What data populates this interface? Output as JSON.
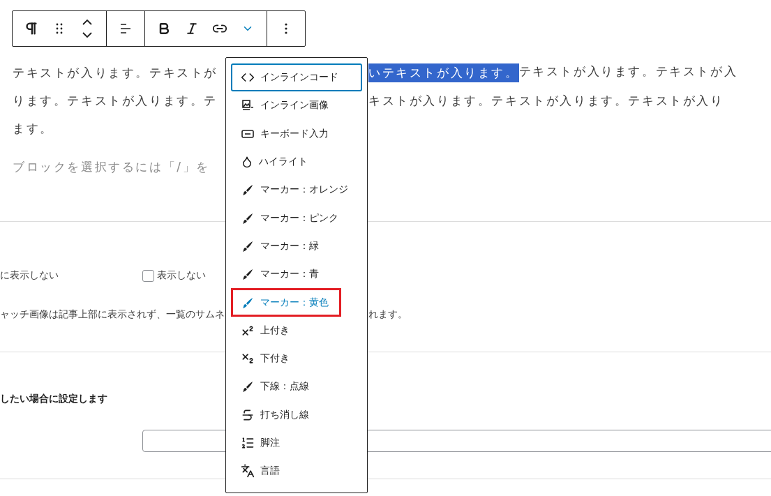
{
  "toolbar": {
    "groups": [
      {
        "buttons": [
          {
            "kind": "paragraph"
          },
          {
            "kind": "drag"
          },
          {
            "kind": "move"
          }
        ]
      },
      {
        "buttons": [
          {
            "kind": "align"
          }
        ]
      },
      {
        "buttons": [
          {
            "kind": "bold"
          },
          {
            "kind": "italic"
          },
          {
            "kind": "link"
          },
          {
            "kind": "more-formats",
            "expanded": true
          }
        ]
      },
      {
        "buttons": [
          {
            "kind": "options"
          }
        ]
      }
    ]
  },
  "paragraph": {
    "lines": [
      {
        "left": "テキストが入ります。テキストが",
        "selected_text": "いテキストが入ります。",
        "right": "テキストが入ります。テキストが入"
      },
      {
        "left": "ります。テキストが入ります。テ",
        "right": "キストが入ります。テキストが入ります。テキストが入り"
      },
      {
        "left": "ます。"
      }
    ]
  },
  "placeholder": "ブロックを選択するには「/」を",
  "settings": {
    "label_left": "に表示しない",
    "checkbox": {
      "label": "表示しない",
      "checked": false
    },
    "note_left": "ャッチ画像は記事上部に表示されず、一覧のサムネ",
    "note_right": "れます。",
    "section_title": "したい場合に設定します"
  },
  "format_menu": {
    "items": [
      {
        "kind": "code",
        "label": "インラインコード",
        "focused": true,
        "active": false,
        "marked": false
      },
      {
        "kind": "image",
        "label": "インライン画像",
        "focused": false,
        "active": false,
        "marked": false
      },
      {
        "kind": "keyboard",
        "label": "キーボード入力",
        "focused": false,
        "active": false,
        "marked": false
      },
      {
        "kind": "drop",
        "label": "ハイライト",
        "focused": false,
        "active": false,
        "marked": false
      },
      {
        "kind": "brush",
        "label": "マーカー：オレンジ",
        "focused": false,
        "active": false,
        "marked": false
      },
      {
        "kind": "brush",
        "label": "マーカー：ピンク",
        "focused": false,
        "active": false,
        "marked": false
      },
      {
        "kind": "brush",
        "label": "マーカー：緑",
        "focused": false,
        "active": false,
        "marked": false
      },
      {
        "kind": "brush",
        "label": "マーカー：青",
        "focused": false,
        "active": false,
        "marked": false
      },
      {
        "kind": "brush",
        "label": "マーカー：黄色",
        "focused": false,
        "active": true,
        "marked": true
      },
      {
        "kind": "superscript",
        "label": "上付き",
        "focused": false,
        "active": false,
        "marked": false
      },
      {
        "kind": "subscript",
        "label": "下付き",
        "focused": false,
        "active": false,
        "marked": false
      },
      {
        "kind": "brush",
        "label": "下線：点線",
        "focused": false,
        "active": false,
        "marked": false
      },
      {
        "kind": "strikethrough",
        "label": "打ち消し線",
        "focused": false,
        "active": false,
        "marked": false
      },
      {
        "kind": "footnote",
        "label": "脚注",
        "focused": false,
        "active": false,
        "marked": false
      },
      {
        "kind": "language",
        "label": "言語",
        "focused": false,
        "active": false,
        "marked": false
      }
    ]
  }
}
